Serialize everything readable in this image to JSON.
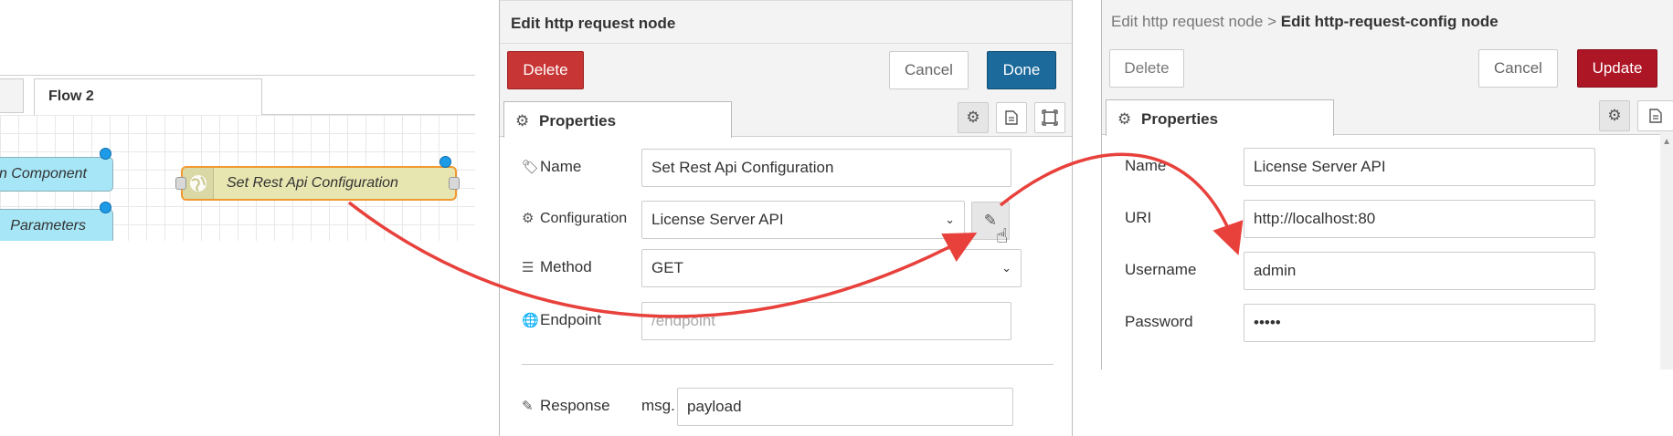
{
  "canvas": {
    "tab_label": "Flow 2",
    "nodes": {
      "component_label": "n Component",
      "parameters_label": "Parameters",
      "set_rest_label": "Set Rest Api Configuration"
    }
  },
  "editor1": {
    "title": "Edit http request node",
    "buttons": {
      "delete": "Delete",
      "cancel": "Cancel",
      "done": "Done"
    },
    "tab_label": "Properties",
    "fields": {
      "name_label": "Name",
      "name_value": "Set Rest Api Configuration",
      "configuration_label": "Configuration",
      "configuration_value": "License Server API",
      "method_label": "Method",
      "method_value": "GET",
      "endpoint_label": "Endpoint",
      "endpoint_placeholder": "/endpoint",
      "response_label": "Response",
      "response_prefix": "msg.",
      "response_value": "payload"
    }
  },
  "editor2": {
    "breadcrumb_parent": "Edit http request node",
    "breadcrumb_sep": ">",
    "breadcrumb_current": "Edit http-request-config node",
    "buttons": {
      "delete": "Delete",
      "cancel": "Cancel",
      "update": "Update"
    },
    "tab_label": "Properties",
    "fields": {
      "name_label": "Name",
      "name_value": "License Server API",
      "uri_label": "URI",
      "uri_value": "http://localhost:80",
      "username_label": "Username",
      "username_value": "admin",
      "password_label": "Password",
      "password_value": "•••••"
    }
  },
  "colors": {
    "delete_red": "#c83535",
    "done_blue": "#1b6a9b",
    "update_red": "#ad1625",
    "annotation_arrow": "#e8413c",
    "node_cyan": "#a6e6f6",
    "node_selected_border": "#f29830",
    "port_blue": "#1e9be6"
  },
  "icons": {
    "properties_tab": "gear-icon",
    "description_tab": "file-icon",
    "appearance_tab": "frame-icon",
    "name_field": "tag-icon",
    "configuration_field": "cog-icon",
    "method_field": "list-icon",
    "endpoint_field": "globe-icon",
    "response_field": "edit-icon",
    "edit_config": "pencil-icon",
    "cursor": "hand-pointer-icon"
  }
}
